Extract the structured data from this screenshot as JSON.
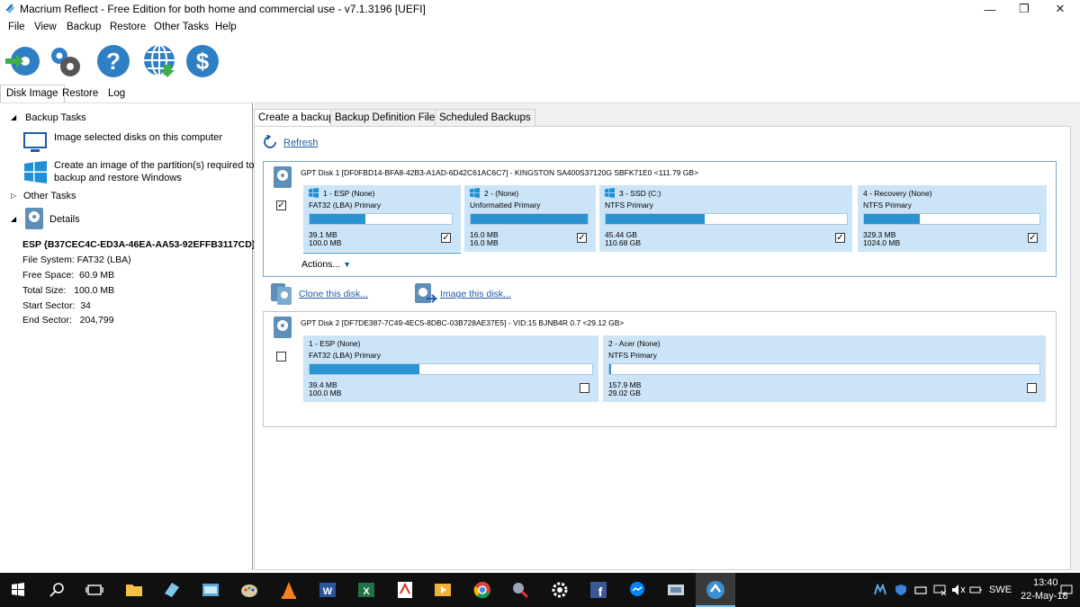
{
  "window": {
    "title": "Macrium Reflect - Free Edition for both home and commercial use - v7.1.3196  [UEFI]"
  },
  "menu": [
    "File",
    "View",
    "Backup",
    "Restore",
    "Other Tasks",
    "Help"
  ],
  "toolbar_icons": [
    "backup-arrow-icon",
    "settings-gears-icon",
    "help-icon",
    "web-update-icon",
    "buy-icon"
  ],
  "view_tabs": [
    "Disk Image",
    "Restore",
    "Log"
  ],
  "left": {
    "backup_tasks": "Backup Tasks",
    "task1": "Image selected disks on this computer",
    "task2_line1": "Create an image of the partition(s) required to",
    "task2_line2": "backup and restore Windows",
    "other_tasks": "Other Tasks",
    "details": "Details",
    "partition_id": "ESP {B37CEC4C-ED3A-46EA-AA53-92EFFB3117CD}",
    "file_system": "File System: FAT32 (LBA)",
    "free_space": "Free Space:  60.9 MB",
    "total_size": "Total Size:   100.0 MB",
    "start_sector": "Start Sector:  34",
    "end_sector": "End Sector:   204,799"
  },
  "content_tabs": [
    "Create a backup",
    "Backup Definition Files",
    "Scheduled Backups"
  ],
  "refresh": "Refresh",
  "disk1": {
    "header": "GPT Disk 1 [DF0FBD14-BFA8-42B3-A1AD-6D42C61AC6C7] - KINGSTON SA400S37120G SBFK71E0  <111.79 GB>",
    "checked": true,
    "actions": "Actions...",
    "partitions": [
      {
        "name": "1 - ESP (None)",
        "type": "FAT32 (LBA) Primary",
        "used": "39.1 MB",
        "total": "100.0 MB",
        "fill": 0.39,
        "checked": true,
        "winlogo": true
      },
      {
        "name": "2 -  (None)",
        "type": "Unformatted Primary",
        "used": "16.0 MB",
        "total": "16.0 MB",
        "fill": 1.0,
        "checked": true,
        "winlogo": true
      },
      {
        "name": "3 - SSD (C:)",
        "type": "NTFS Primary",
        "used": "45.44 GB",
        "total": "110.68 GB",
        "fill": 0.41,
        "checked": true,
        "winlogo": true
      },
      {
        "name": "4 - Recovery (None)",
        "type": "NTFS Primary",
        "used": "329.3 MB",
        "total": "1024.0 MB",
        "fill": 0.32,
        "checked": true,
        "winlogo": false
      }
    ]
  },
  "clone_link": "Clone this disk...",
  "image_link": "Image this disk...",
  "disk2": {
    "header": "GPT Disk 2 [DF7DE387-7C49-4EC5-8DBC-03B728AE37E5] - VID:15 BJNB4R 0.7  <29.12 GB>",
    "checked": false,
    "partitions": [
      {
        "name": "1 - ESP (None)",
        "type": "FAT32 (LBA) Primary",
        "used": "39.4 MB",
        "total": "100.0 MB",
        "fill": 0.39,
        "checked": false
      },
      {
        "name": "2 - Acer (None)",
        "type": "NTFS Primary",
        "used": "157.9 MB",
        "total": "29.02 GB",
        "fill": 0.005,
        "checked": false
      }
    ]
  },
  "taskbar": {
    "time": "13:40",
    "date": "22-May-18",
    "lang": "SWE"
  },
  "colors": {
    "accent": "#2b93d1",
    "partition_bg": "#cce4f7",
    "link": "#1f5ba6"
  }
}
